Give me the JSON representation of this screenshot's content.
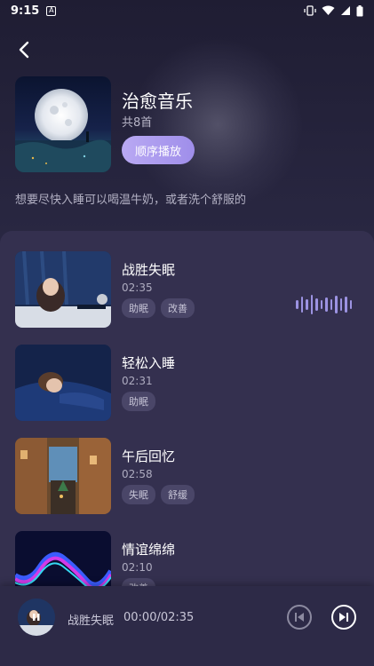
{
  "status_bar": {
    "time": "9:15",
    "notif_letter": "A"
  },
  "playlist": {
    "title": "治愈音乐",
    "count": "共8首",
    "play_order_label": "顺序播放",
    "description": "想要尽快入睡可以喝温牛奶，或者洗个舒服的"
  },
  "songs": [
    {
      "title": "战胜失眠",
      "duration": "02:35",
      "tags": [
        "助眠",
        "改善"
      ],
      "playing": true
    },
    {
      "title": "轻松入睡",
      "duration": "02:31",
      "tags": [
        "助眠"
      ],
      "playing": false
    },
    {
      "title": "午后回忆",
      "duration": "02:58",
      "tags": [
        "失眠",
        "舒缓"
      ],
      "playing": false
    },
    {
      "title": "情谊绵绵",
      "duration": "02:10",
      "tags": [
        "改善"
      ],
      "playing": false
    }
  ],
  "player": {
    "now_playing_title": "战胜失眠",
    "time_display": "00:00/02:35"
  },
  "colors": {
    "background": "#262440",
    "panel": "#34304f",
    "accent": "#a999ef",
    "tag_bg": "#4a4668"
  },
  "icons": {
    "back": "back-arrow-icon",
    "prev": "previous-track-icon",
    "next": "next-track-icon",
    "wave": "sound-wave-icon"
  }
}
